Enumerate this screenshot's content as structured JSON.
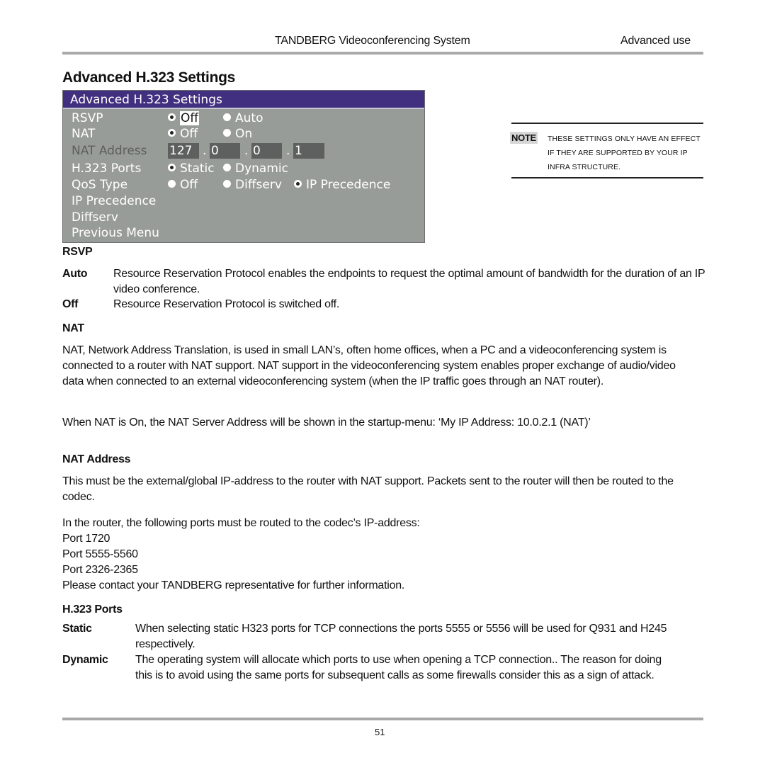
{
  "header": {
    "doc_title": "TANDBERG Videoconferencing System",
    "section": "Advanced use"
  },
  "page_title": "Advanced H.323 Settings",
  "osd_menu": {
    "title": "Advanced H.323 Settings",
    "rows": [
      {
        "label": "RSVP",
        "options": [
          "Off",
          "Auto"
        ],
        "selected": "Off",
        "focused": "Off"
      },
      {
        "label": "NAT",
        "options": [
          "Off",
          "On"
        ],
        "selected": "Off"
      },
      {
        "label": "NAT Address",
        "disabled": true,
        "ip": [
          "127",
          "0",
          "0",
          "1"
        ]
      },
      {
        "label": "H.323 Ports",
        "options": [
          "Static",
          "Dynamic"
        ],
        "selected": "Static"
      },
      {
        "label": "QoS Type",
        "options": [
          "Off",
          "Diffserv",
          "IP Precedence"
        ],
        "selected": "IP Precedence"
      },
      {
        "label": "IP Precedence"
      },
      {
        "label": "Diffserv"
      },
      {
        "label": "Previous Menu"
      }
    ],
    "ip_separator": "."
  },
  "note": {
    "tag": "NOTE",
    "text": "These settings only have an effect if they are supported by your IP infra structure."
  },
  "sections": {
    "rsvp": {
      "heading": "RSVP",
      "items": [
        {
          "term": "Auto",
          "desc": "Resource Reservation Protocol enables the endpoints to request the optimal amount of bandwidth for the duration of an IP video conference."
        },
        {
          "term": "Off",
          "desc": "Resource Reservation Protocol is switched off."
        }
      ]
    },
    "nat": {
      "heading": "NAT",
      "para1": "NAT, Network Address Translation, is used in small LAN’s, often home offices, when a PC and a videoconferencing system is connected to a router with NAT support. NAT support in the videoconferencing system enables proper exchange of audio/video data when connected to an external videoconferencing system (when the IP traffic goes through an NAT router).",
      "para2": "When NAT is On, the NAT Server Address will be shown in the startup-menu:  ‘My IP Address: 10.0.2.1 (NAT)’"
    },
    "nat_address": {
      "heading": "NAT Address",
      "para1": "This must be the external/global IP-address to the router with NAT support. Packets sent to the router will then be routed to the codec.",
      "lines": [
        "In the router, the following ports must be routed to the codec’s IP-address:",
        "Port 1720",
        "Port 5555-5560",
        "Port 2326-2365",
        "Please contact your TANDBERG representative for further information."
      ]
    },
    "h323_ports": {
      "heading": "H.323 Ports",
      "items": [
        {
          "term": "Static",
          "desc": "When selecting static H323 ports for TCP connections the ports 5555 or 5556 will be used for Q931 and  H245 respectively."
        },
        {
          "term": "Dynamic",
          "desc": "The operating system will allocate which ports to use when opening a TCP connection.. The reason for doing this is to avoid using the same ports for subsequent calls as some firewalls consider this as a sign of attack."
        }
      ]
    }
  },
  "footer": {
    "page_number": "51"
  }
}
